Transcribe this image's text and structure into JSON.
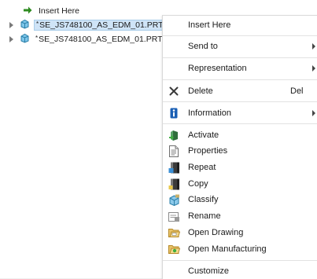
{
  "tree": {
    "insert_here": "Insert Here",
    "items": [
      {
        "label": "SE_JS748100_AS_EDM_01.PRT",
        "marker": "*"
      },
      {
        "label": "SE_JS748100_AS_EDM_01.PRT",
        "marker": "*"
      }
    ]
  },
  "context_menu": {
    "insert_here": "Insert Here",
    "send_to": "Send to",
    "representation": "Representation",
    "delete": {
      "label": "Delete",
      "shortcut": "Del"
    },
    "information": "Information",
    "activate": "Activate",
    "properties": "Properties",
    "repeat": "Repeat",
    "copy": "Copy",
    "classify": "Classify",
    "rename": "Rename",
    "open_drawing": "Open Drawing",
    "open_manufacturing": "Open Manufacturing",
    "customize": "Customize"
  },
  "icons": {
    "insert_arrow": "green-arrow-right-icon",
    "part": "part-cube-icon",
    "delete": "delete-x-icon",
    "information": "information-icon",
    "activate": "activate-icon",
    "properties": "properties-icon",
    "repeat": "repeat-icon",
    "copy": "copy-icon",
    "classify": "classify-icon",
    "rename": "rename-icon",
    "open_drawing": "open-drawing-icon",
    "open_manufacturing": "open-manufacturing-icon"
  },
  "colors": {
    "selection_bg": "#cfe4f7",
    "insert_arrow": "#2e8b20",
    "info_blue": "#1a5fb4"
  }
}
